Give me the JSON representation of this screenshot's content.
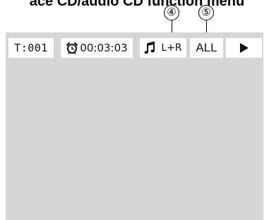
{
  "heading": "ace CD/audio CD function menu",
  "callouts": {
    "c4": "④",
    "c5": "⑤"
  },
  "menu": {
    "track": "T:001",
    "elapsed_time": "00:03:03",
    "audio_channel": "L+R",
    "repeat_mode": "ALL"
  },
  "icons": {
    "clock": "alarm-clock-icon",
    "audio": "music-note-icon",
    "play": "play-icon"
  }
}
